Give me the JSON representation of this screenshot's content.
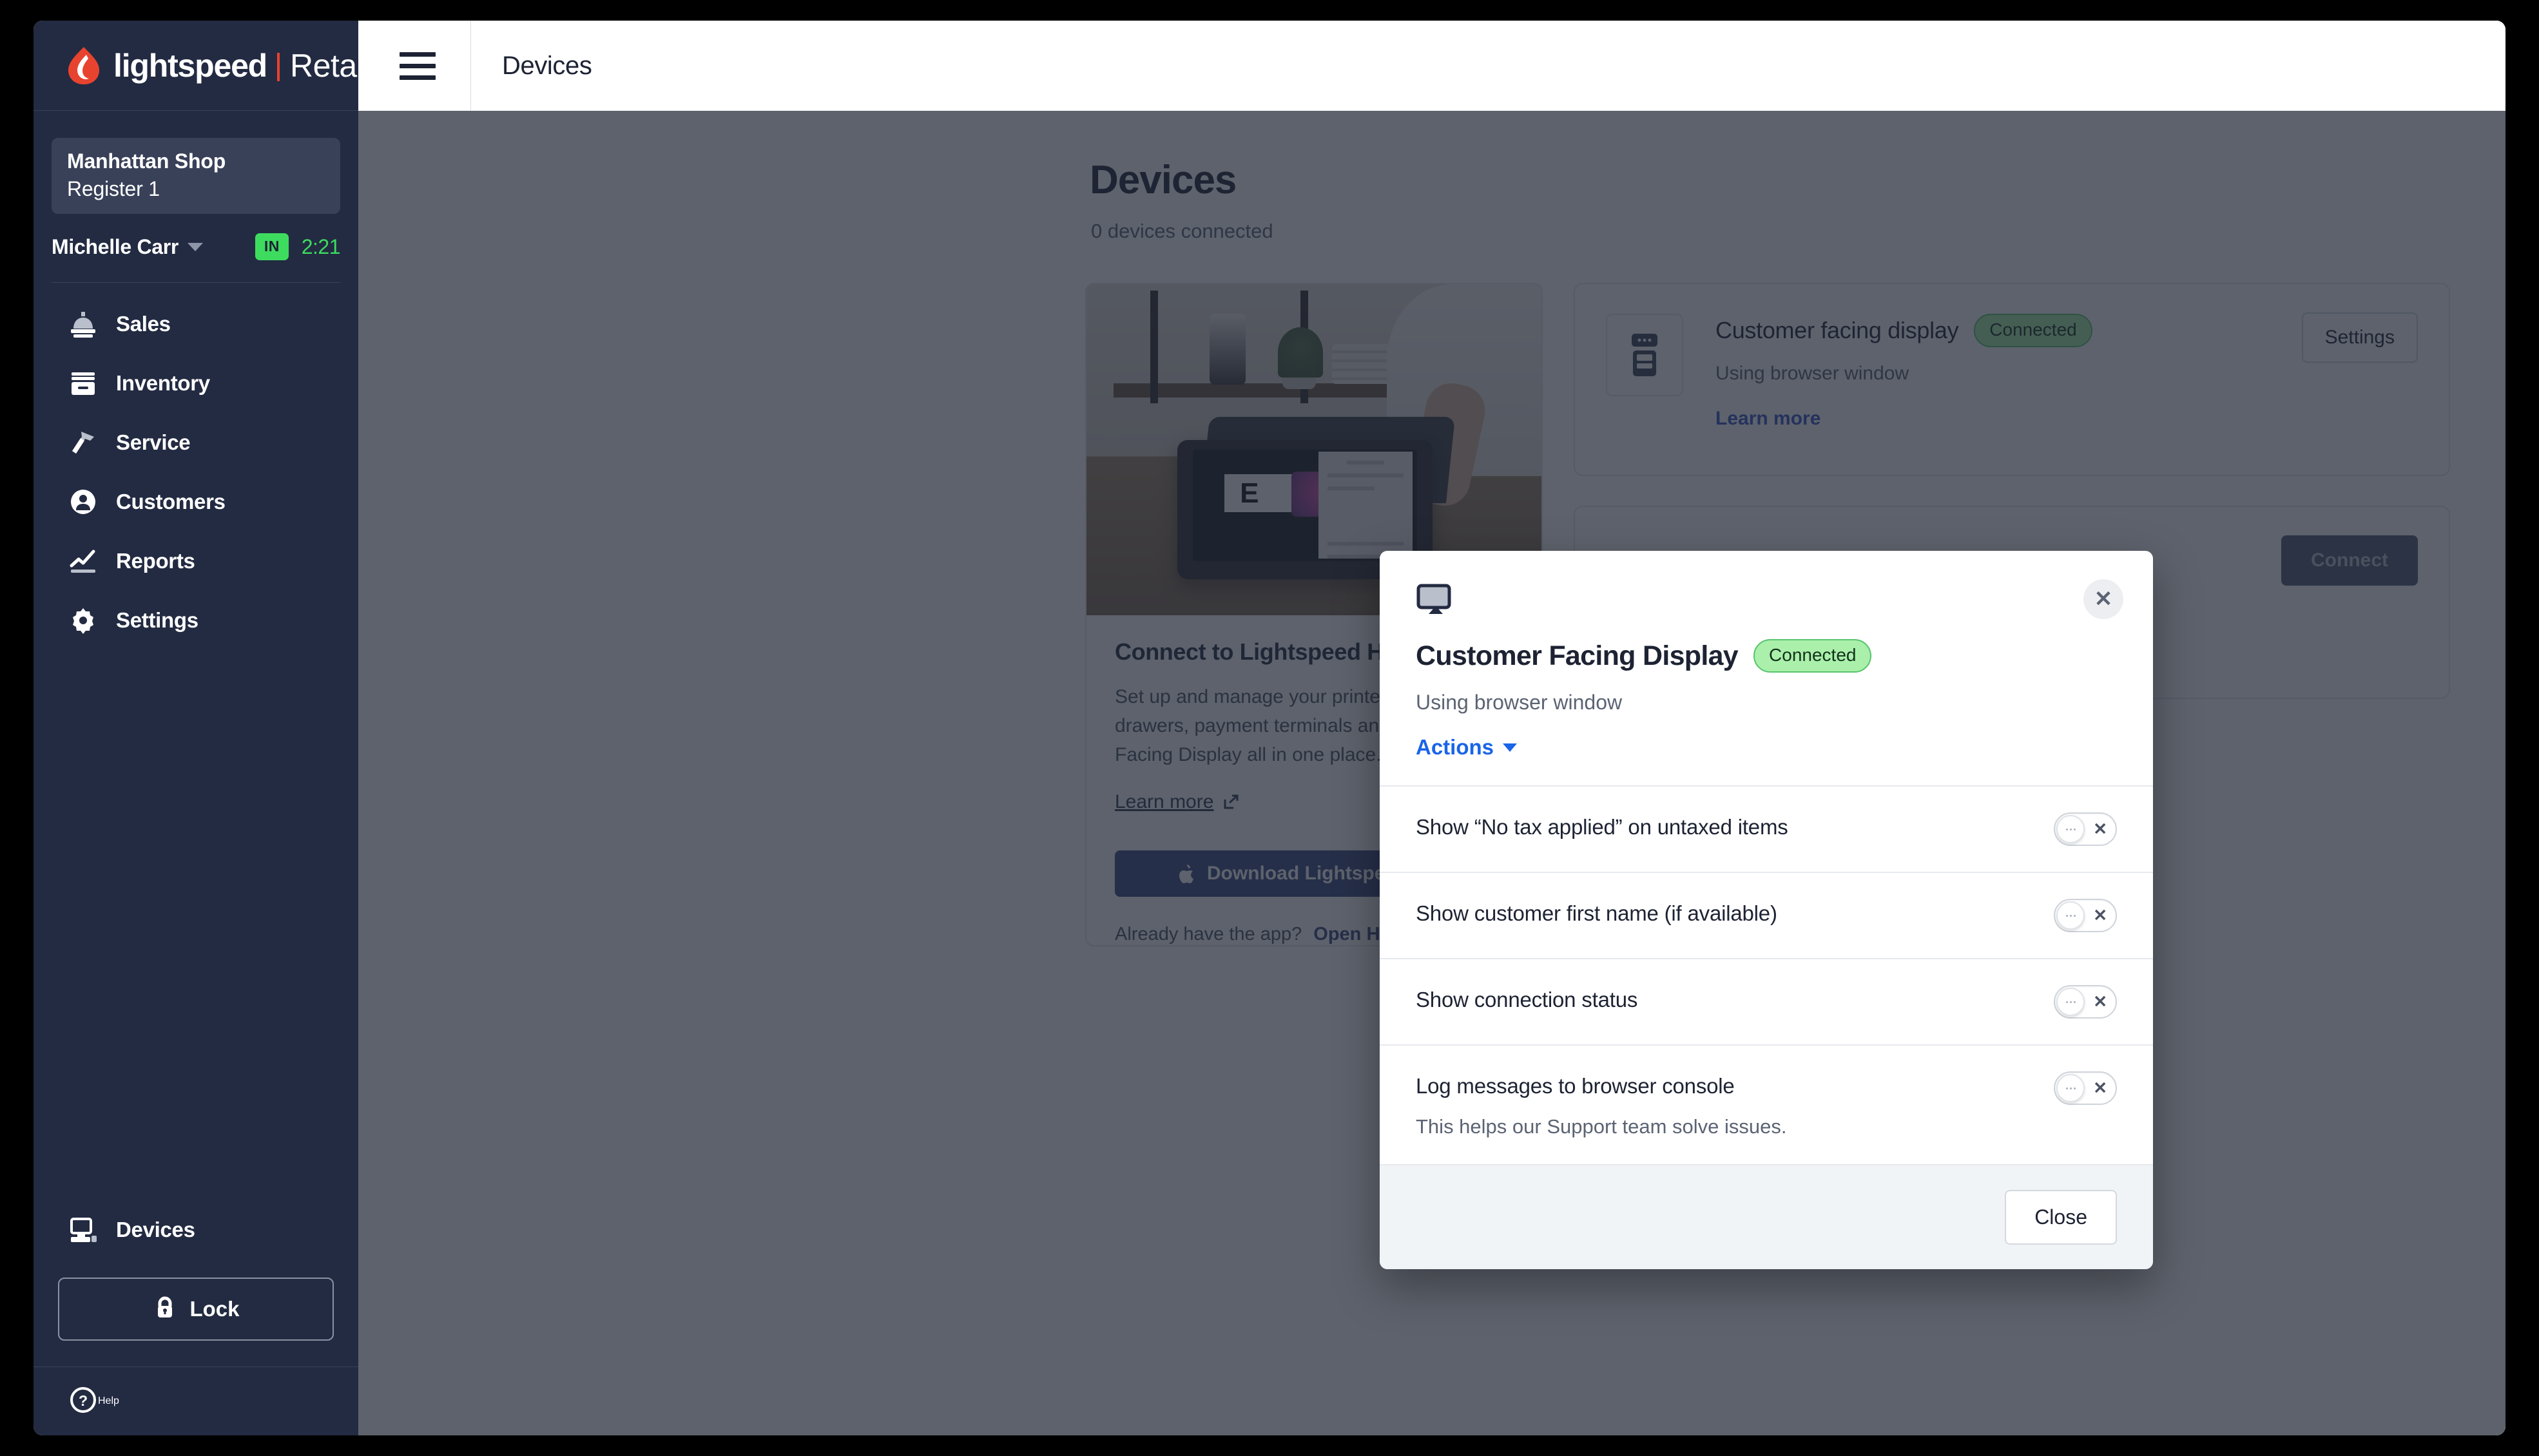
{
  "brand": {
    "name": "lightspeed",
    "product": "Retail",
    "logo_color": "#e8432f"
  },
  "sidebar": {
    "shop": {
      "name": "Manhattan Shop",
      "register": "Register 1"
    },
    "user": {
      "name": "Michelle Carr",
      "status_badge": "IN",
      "clock": "2:21",
      "status_color": "#3ddc5f"
    },
    "items": [
      {
        "label": "Sales",
        "icon": "register-bell-icon"
      },
      {
        "label": "Inventory",
        "icon": "inventory-box-icon"
      },
      {
        "label": "Service",
        "icon": "hammer-icon"
      },
      {
        "label": "Customers",
        "icon": "person-circle-icon"
      },
      {
        "label": "Reports",
        "icon": "line-chart-icon"
      },
      {
        "label": "Settings",
        "icon": "gear-icon"
      }
    ],
    "devices_label": "Devices",
    "lock_label": "Lock",
    "help_label": "Help"
  },
  "topbar": {
    "menu_icon": "hamburger-icon",
    "title": "Devices"
  },
  "page": {
    "title": "Devices",
    "subtitle": "0 devices connected",
    "hub_card": {
      "heading": "Connect to Lightspeed Hub",
      "body": "Set up and manage your printers, cash drawers, payment terminals and Customer Facing Display all in one place.",
      "learn_more": "Learn more",
      "download_button": "Download Lightspeed Hub",
      "already_text": "Already have the app?",
      "open_hub_link": "Open Hub"
    },
    "device_cards": [
      {
        "title": "Customer facing display",
        "status": "Connected",
        "subtitle": "Using browser window",
        "learn_more": "Learn more",
        "action": "Settings",
        "icon": "payment-terminal-icon"
      },
      {
        "action": "Connect"
      }
    ]
  },
  "modal": {
    "icon": "monitor-icon",
    "close_icon": "close-icon",
    "title": "Customer Facing Display",
    "status": "Connected",
    "status_bg": "#aaf0aa",
    "status_border": "#57c46e",
    "subtitle": "Using browser window",
    "actions_label": "Actions",
    "options": [
      {
        "label": "Show “No tax applied” on untaxed items",
        "help": "",
        "state": "off"
      },
      {
        "label": "Show customer first name (if available)",
        "help": "",
        "state": "off"
      },
      {
        "label": "Show connection status",
        "help": "",
        "state": "off"
      },
      {
        "label": "Log messages to browser console",
        "help": "This helps our Support team solve issues.",
        "state": "off"
      }
    ],
    "close_button": "Close"
  }
}
